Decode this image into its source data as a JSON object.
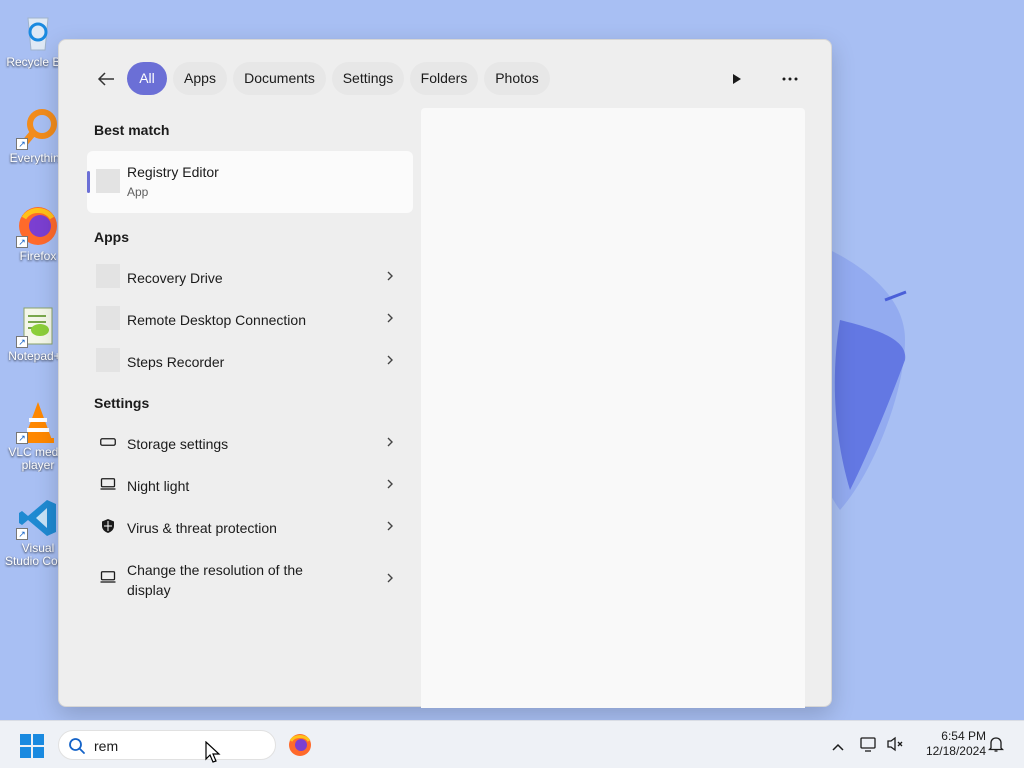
{
  "desktop": {
    "icons": [
      {
        "label": "Recycle Bin",
        "icon": "recycle-bin-icon"
      },
      {
        "label": "Everything",
        "icon": "everything-search-icon"
      },
      {
        "label": "Firefox",
        "icon": "firefox-icon"
      },
      {
        "label": "Notepad++",
        "icon": "notepad-plus-plus-icon"
      },
      {
        "label": "VLC media player",
        "icon": "vlc-icon"
      },
      {
        "label": "Visual Studio Code",
        "icon": "vscode-icon"
      }
    ]
  },
  "search_panel": {
    "filters": [
      "All",
      "Apps",
      "Documents",
      "Settings",
      "Folders",
      "Photos"
    ],
    "active_filter": "All",
    "best_match": {
      "heading": "Best match",
      "title": "Registry Editor",
      "subtitle": "App"
    },
    "apps": {
      "heading": "Apps",
      "items": [
        {
          "label": "Recovery Drive"
        },
        {
          "label": "Remote Desktop Connection"
        },
        {
          "label": "Steps Recorder"
        }
      ]
    },
    "settings": {
      "heading": "Settings",
      "items": [
        {
          "label": "Storage settings",
          "icon": "storage-icon"
        },
        {
          "label": "Night light",
          "icon": "display-icon"
        },
        {
          "label": "Virus & threat protection",
          "icon": "shield-icon"
        },
        {
          "label": "Change the resolution of the display",
          "icon": "display-icon"
        }
      ]
    }
  },
  "taskbar": {
    "search_value": "rem",
    "time": "6:54 PM",
    "date": "12/18/2024"
  },
  "colors": {
    "accent": "#6b6fd6",
    "wallpaper": "#a8bff3"
  }
}
